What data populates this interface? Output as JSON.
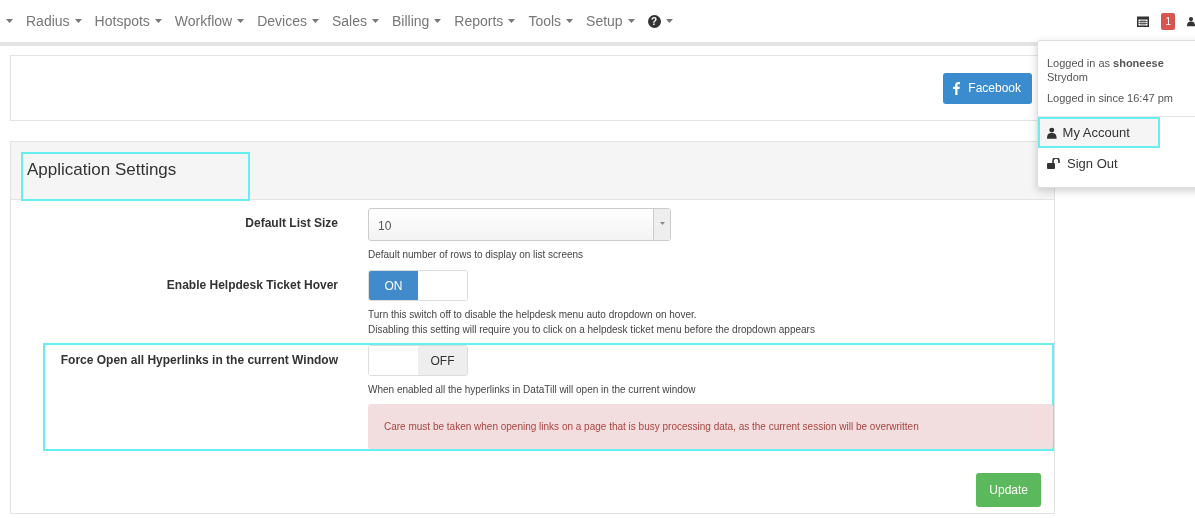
{
  "nav": {
    "items": [
      {
        "kind": "cut"
      },
      {
        "label": "Radius"
      },
      {
        "label": "Hotspots"
      },
      {
        "label": "Workflow"
      },
      {
        "label": "Devices"
      },
      {
        "label": "Sales"
      },
      {
        "label": "Billing"
      },
      {
        "label": "Reports"
      },
      {
        "label": "Tools"
      },
      {
        "label": "Setup"
      },
      {
        "kind": "help",
        "symbol": "?"
      }
    ],
    "badge": "1"
  },
  "social": {
    "button": "Facebook"
  },
  "user_menu": {
    "logged_in_as": "Logged in as **shoneese** Strydom",
    "since": "Logged in since 16:47 pm",
    "items": [
      {
        "label": "My Account",
        "kind": "account",
        "selected": true
      },
      {
        "label": "Sign Out",
        "kind": "signout",
        "selected": false
      }
    ]
  },
  "panel": {
    "title": "Application Settings",
    "title_highlighted": true,
    "settings": [
      {
        "kind": "select",
        "label": "Default List Size",
        "value": "10",
        "help": [
          "Default number of rows to display on list screens"
        ],
        "highlighted": false
      },
      {
        "kind": "switch",
        "label": "Enable Helpdesk Ticket Hover",
        "on": true,
        "text": "ON",
        "help": [
          "Turn this switch off to disable the helpdesk menu auto dropdown on hover.",
          "Disabling this setting will require you to click on a helpdesk ticket menu before the dropdown appears"
        ],
        "highlighted": false
      },
      {
        "kind": "switch",
        "label": "Force Open all Hyperlinks in the current Window",
        "on": false,
        "text": "OFF",
        "help": [
          "When enabled all the hyperlinks in DataTill will open in the current window"
        ],
        "alert": "Care must be taken when opening links on a page that is busy processing data, as the current session will be overwritten",
        "highlighted": true
      }
    ],
    "submit": "Update"
  }
}
